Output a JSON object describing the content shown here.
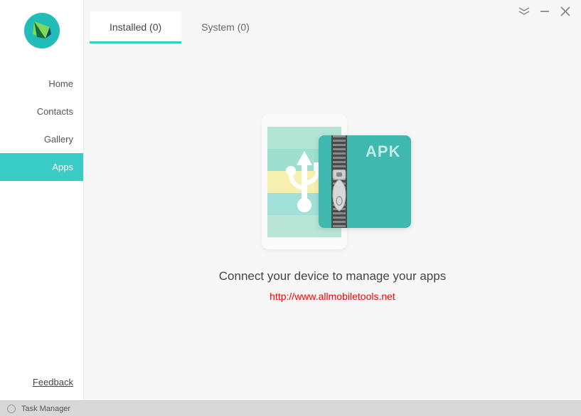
{
  "sidebar": {
    "items": [
      {
        "label": "Home"
      },
      {
        "label": "Contacts"
      },
      {
        "label": "Gallery"
      },
      {
        "label": "Apps"
      }
    ],
    "feedback_label": "Feedback"
  },
  "tabs": [
    {
      "label": "Installed (0)",
      "active": true
    },
    {
      "label": "System (0)",
      "active": false
    }
  ],
  "empty_state": {
    "apk_label": "APK",
    "message": "Connect your device to manage your apps",
    "watermark": "http://www.allmobiletools.net"
  },
  "statusbar": {
    "label": "Task Manager"
  },
  "colors": {
    "accent": "#39ccc4",
    "watermark": "#ff0000"
  }
}
